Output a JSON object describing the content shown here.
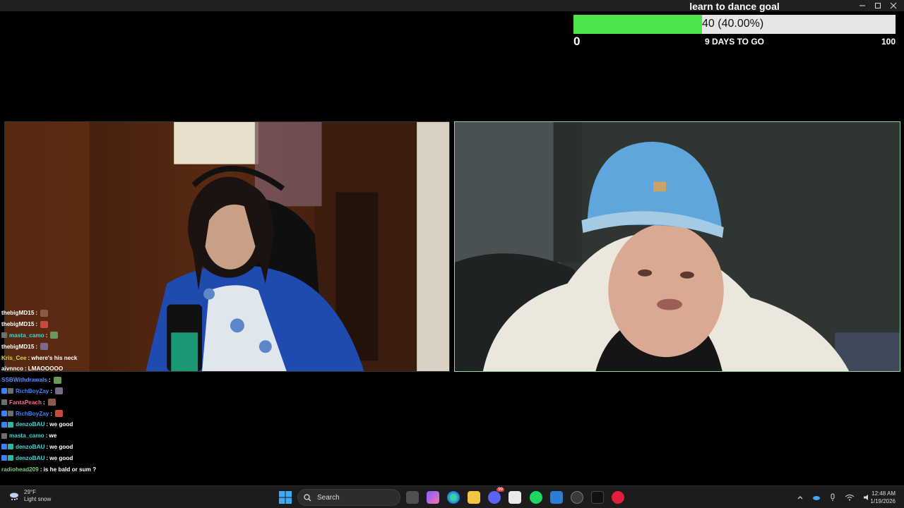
{
  "goal": {
    "title": "learn to dance goal",
    "bar_text": "40 (40.00%)",
    "progress_fraction": 0.4,
    "min": "0",
    "max": "100",
    "days_left": "9 DAYS TO GO"
  },
  "chat": {
    "messages": [
      {
        "user": "thebigMD15",
        "color": "#ffffff",
        "sep": ":",
        "text": "",
        "emote": true,
        "badges": []
      },
      {
        "user": "thebigMD15",
        "color": "#ffffff",
        "sep": ":",
        "text": "",
        "emote": true,
        "badges": []
      },
      {
        "user": "masta_camo",
        "color": "#3fd5d5",
        "sep": ":",
        "text": "",
        "emote": true,
        "badges": [
          "sub"
        ]
      },
      {
        "user": "thebigMD15",
        "color": "#ffffff",
        "sep": ":",
        "text": "",
        "emote": true,
        "badges": []
      },
      {
        "user": "Kris_Cee",
        "color": "#e6d14a",
        "sep": ":",
        "text": "where's his neck",
        "emote": false,
        "badges": []
      },
      {
        "user": "aivnnco",
        "color": "#ffffff",
        "sep": ":",
        "text": "LMAOOOOO",
        "emote": false,
        "badges": []
      },
      {
        "user": "SSBWithdrawals",
        "color": "#5b8cff",
        "sep": ":",
        "text": "",
        "emote": true,
        "badges": []
      },
      {
        "user": "RichBoyZay",
        "color": "#3b82f6",
        "sep": ":",
        "text": "",
        "emote": true,
        "badges": [
          "vip",
          "sub"
        ]
      },
      {
        "user": "FantaPeach",
        "color": "#ff6b8a",
        "sep": ":",
        "text": "",
        "emote": true,
        "badges": [
          "sub"
        ]
      },
      {
        "user": "RichBoyZay",
        "color": "#3b82f6",
        "sep": ":",
        "text": "",
        "emote": true,
        "badges": [
          "vip",
          "sub"
        ]
      },
      {
        "user": "denzoBAU",
        "color": "#3fd5d5",
        "sep": ":",
        "text": "we good",
        "emote": false,
        "badges": [
          "vip",
          "gift"
        ]
      },
      {
        "user": "masta_camo",
        "color": "#3fd5d5",
        "sep": ":",
        "text": "we",
        "emote": false,
        "badges": [
          "sub"
        ]
      },
      {
        "user": "denzoBAU",
        "color": "#3fd5d5",
        "sep": ":",
        "text": "we good",
        "emote": false,
        "badges": [
          "vip",
          "gift"
        ]
      },
      {
        "user": "denzoBAU",
        "color": "#3fd5d5",
        "sep": ":",
        "text": "we good",
        "emote": false,
        "badges": [
          "vip",
          "gift"
        ]
      },
      {
        "user": "radiohead209",
        "color": "#7fc97f",
        "sep": ":",
        "text": "is he bald or sum ?",
        "emote": false,
        "badges": []
      }
    ]
  },
  "taskbar": {
    "weather_temp": "29°F",
    "weather_desc": "Light snow",
    "search_label": "Search",
    "time": "12:48 AM",
    "date": "1/19/2026",
    "pinned_icons": [
      "file-explorer-icon",
      "copilot-icon",
      "edge-icon",
      "folder-icon",
      "discord-icon",
      "store-icon",
      "spotify-icon",
      "mail-icon",
      "obs-icon",
      "tiktok-icon",
      "opera-icon"
    ],
    "discord_badge": "99"
  },
  "colors": {
    "progress_fill": "#4de34a",
    "progress_track": "#e6e6e6",
    "right_cam_border": "#8fd7a0",
    "taskbar_bg": "#1c1c1c"
  }
}
